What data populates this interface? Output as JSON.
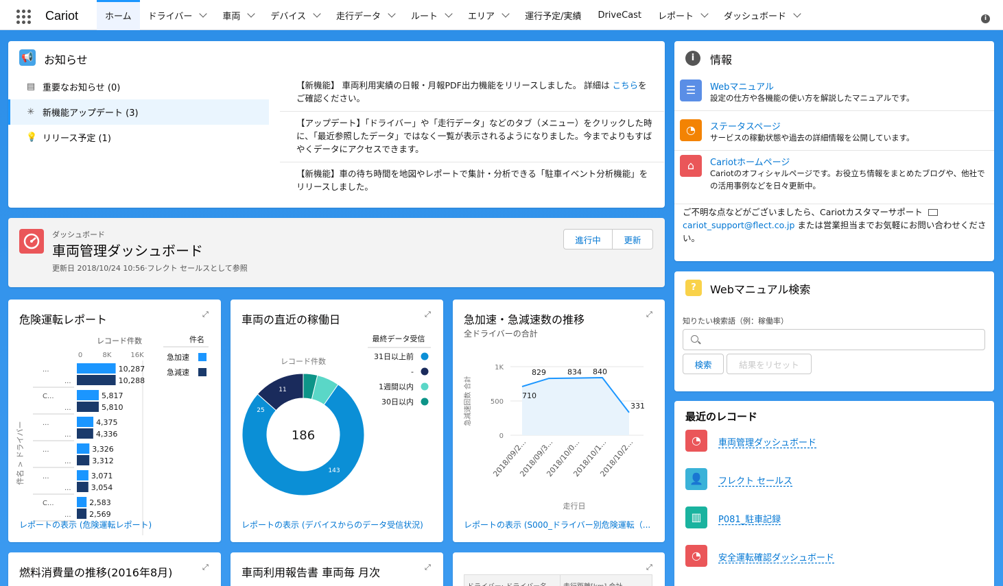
{
  "app": {
    "name": "Cariot"
  },
  "nav": {
    "tabs": [
      {
        "label": "ホーム",
        "active": true,
        "chevron": false
      },
      {
        "label": "ドライバー",
        "chevron": true
      },
      {
        "label": "車両",
        "chevron": true
      },
      {
        "label": "デバイス",
        "chevron": true
      },
      {
        "label": "走行データ",
        "chevron": true
      },
      {
        "label": "ルート",
        "chevron": true
      },
      {
        "label": "エリア",
        "chevron": true
      },
      {
        "label": "運行予定/実績",
        "chevron": false
      },
      {
        "label": "DriveCast",
        "chevron": false
      },
      {
        "label": "レポート",
        "chevron": true
      },
      {
        "label": "ダッシュボード",
        "chevron": true
      }
    ]
  },
  "announcements": {
    "title": "お知らせ",
    "categories": [
      {
        "label": "重要なお知らせ (0)",
        "icon": "news-icon"
      },
      {
        "label": "新機能アップデート (3)",
        "icon": "sparkle-icon",
        "selected": true
      },
      {
        "label": "リリース予定 (1)",
        "icon": "bulb-icon"
      }
    ],
    "entries": [
      {
        "pre": "【新機能】 車両利用実績の日報・月報PDF出力機能をリリースしました。 詳細は ",
        "link": "こちら",
        "post": "をご確認ください。"
      },
      {
        "text": "【アップデート】「ドライバー」や「走行データ」などのタブ（メニュー）をクリックした時に、「最近参照したデータ」ではなく一覧が表示されるようになりました。今までよりもすばやくデータにアクセスできます。"
      },
      {
        "text": "【新機能】車の待ち時間を地図やレポートで集計・分析できる「駐車イベント分析機能」をリリースしました。"
      }
    ]
  },
  "dashboard_header": {
    "eyebrow": "ダッシュボード",
    "title": "車両管理ダッシュボード",
    "meta": "更新日 2018/10/24 10:56·フレクト セールスとして参照",
    "btn_progress": "進行中",
    "btn_refresh": "更新"
  },
  "info": {
    "title": "情報",
    "items": [
      {
        "title": "Webマニュアル",
        "desc": "設定の仕方や各機能の使い方を解説したマニュアルです。",
        "color": "#5a8ee6"
      },
      {
        "title": "ステータスページ",
        "desc": "サービスの稼動状態や過去の詳細情報を公開しています。",
        "color": "#f38303"
      },
      {
        "title": "Cariotホームページ",
        "desc": "Cariotのオフィシャルページです。お役立ち情報をまとめたブログや、他社での活用事例などを日々更新中。",
        "color": "#ea5659"
      }
    ],
    "support_pre": "ご不明な点などがございましたら、Cariotカスタマーサポート",
    "support_email": "cariot_support@flect.co.jp",
    "support_post": " または営業担当までお気軽にお問い合わせください。"
  },
  "manual_search": {
    "title": "Webマニュアル検索",
    "label": "知りたい検索語（例：稼働率）",
    "placeholder": "",
    "btn_search": "検索",
    "btn_reset": "結果をリセット"
  },
  "recent": {
    "title": "最近のレコード",
    "items": [
      {
        "label": "車両管理ダッシュボード",
        "color": "#ea5659",
        "icon": "dashboard-icon"
      },
      {
        "label": "フレクト セールス",
        "color": "#3ab2d8",
        "icon": "user-icon"
      },
      {
        "label": "P081_駐車記録",
        "color": "#1ab39f",
        "icon": "report-icon"
      },
      {
        "label": "安全運転確認ダッシュボード",
        "color": "#ea5659",
        "icon": "dashboard-icon"
      }
    ]
  },
  "widgets": {
    "danger": {
      "title": "危険運転レポート",
      "xlabel": "レコード件数",
      "ylabel": "件名 > ドライバー",
      "legend_title": "件名",
      "link": "レポートの表示 (危険運転レポート)"
    },
    "recent_days": {
      "title": "車両の直近の稼働日",
      "center_title": "レコード件数",
      "legend_title": "最終データ受信",
      "link": "レポートの表示 (デバイスからのデータ受信状況)"
    },
    "accel": {
      "title": "急加速・急減速数の推移",
      "subtitle": "全ドライバーの合計",
      "link": "レポートの表示 (S000_ドライバー別危険運転（..."
    },
    "fuel": {
      "title": "燃料消費量の推移(2016年8月)"
    },
    "usage": {
      "title": "車両利用報告書 車両毎 月次"
    },
    "table": {
      "col1": "ドライバー: ドライバー名",
      "col2": "走行距離[km] 合計"
    }
  },
  "chart_data": [
    {
      "type": "bar",
      "title": "危険運転レポート",
      "xlabel": "レコード件数",
      "ylabel": "件名 > ドライバー",
      "xlim": [
        0,
        16000
      ],
      "xticks": [
        "0",
        "8K",
        "16K"
      ],
      "categories": [
        "...",
        "...",
        "C...",
        "...",
        "...",
        "...",
        "...",
        "...",
        "...",
        "...",
        "C...",
        "..."
      ],
      "series": [
        {
          "name": "急加速",
          "color": "#1b96ff",
          "values": [
            10287,
            5817,
            4375,
            3326,
            3071,
            2583
          ]
        },
        {
          "name": "急減速",
          "color": "#1a3a6b",
          "values": [
            10288,
            5810,
            4336,
            3312,
            3054,
            2560
          ]
        }
      ],
      "labels": [
        "10,287",
        "10,288",
        "5,817",
        "5,810",
        "4,375",
        "4,336",
        "3,326",
        "3,312",
        "3,071",
        "3,054",
        "2,583",
        "2,569"
      ]
    },
    {
      "type": "pie",
      "title": "車両の直近の稼働日",
      "total": "186",
      "slices": [
        {
          "name": "30日以内",
          "value": 7,
          "color": "#0d9488"
        },
        {
          "name": "1週間以内",
          "value": 11,
          "color": "#5ad7c7"
        },
        {
          "name": "-",
          "value": 0,
          "color": "#1a2b5c"
        },
        {
          "name": "31日以上前",
          "value": 143,
          "color": "#0b8fd6"
        },
        {
          "name": "25",
          "value": 25,
          "color": "#1a2b5c"
        }
      ],
      "legend": [
        {
          "name": "31日以上前",
          "color": "#0b8fd6"
        },
        {
          "name": "-",
          "color": "#1a2b5c"
        },
        {
          "name": "1週間以内",
          "color": "#5ad7c7"
        },
        {
          "name": "30日以内",
          "color": "#0d9488"
        }
      ],
      "slice_labels": [
        "143",
        "25",
        "11"
      ]
    },
    {
      "type": "line",
      "title": "急加速・急減速数の推移",
      "subtitle": "全ドライバーの合計",
      "xlabel": "走行日",
      "ylabel": "急減速回数 合計",
      "ylim": [
        0,
        1000
      ],
      "yticks": [
        "0",
        "500",
        "1K"
      ],
      "x": [
        "2018/09/2...",
        "2018/09/3...",
        "2018/10/0...",
        "2018/10/1...",
        "2018/10/2..."
      ],
      "values": [
        710,
        829,
        834,
        840,
        331
      ],
      "labels": [
        "710",
        "829",
        "834",
        "840",
        "331"
      ]
    }
  ]
}
